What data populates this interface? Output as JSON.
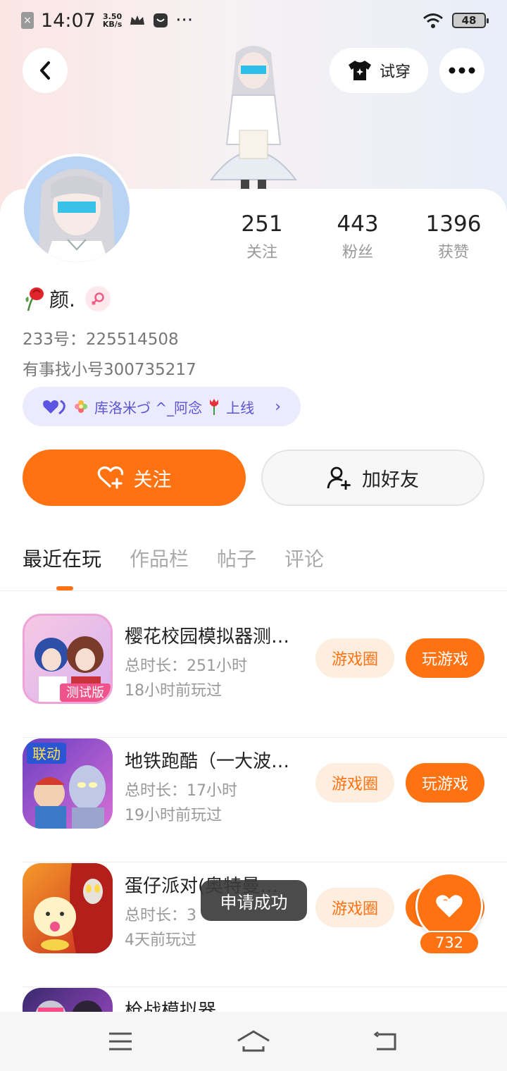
{
  "status_bar": {
    "time": "14:07",
    "speed_top": "3.50",
    "speed_unit": "KB/s",
    "dots": "···",
    "battery": "48"
  },
  "header": {
    "try_on_label": "试穿"
  },
  "profile": {
    "stats": [
      {
        "value": "251",
        "label": "关注"
      },
      {
        "value": "443",
        "label": "粉丝"
      },
      {
        "value": "1396",
        "label": "获赞"
      }
    ],
    "name": "颜.",
    "id_line": "233号：225514508",
    "bio": "有事找小号300735217",
    "guild": "库洛米づ ^_阿念",
    "guild_suffix": "上线",
    "follow_label": "关注",
    "add_friend_label": "加好友"
  },
  "tabs": [
    {
      "label": "最近在玩",
      "active": true
    },
    {
      "label": "作品栏",
      "active": false
    },
    {
      "label": "帖子",
      "active": false
    },
    {
      "label": "评论",
      "active": false
    }
  ],
  "games": [
    {
      "title": "樱花校园模拟器测…",
      "duration": "总时长：251小时",
      "last_played": "18小时前玩过",
      "badge": "测试版"
    },
    {
      "title": "地铁跑酷（一大波…",
      "duration": "总时长：17小时",
      "last_played": "19小时前玩过",
      "badge": "联动"
    },
    {
      "title": "蛋仔派对(奥特曼…",
      "duration": "总时长：3",
      "last_played": "4天前玩过",
      "badge": ""
    },
    {
      "title": "枪战模拟器",
      "duration": "",
      "last_played": "",
      "badge": ""
    }
  ],
  "game_buttons": {
    "circle_label": "游戏圈",
    "play_label": "玩游戏"
  },
  "toast": "申请成功",
  "like_count": "732",
  "colors": {
    "accent": "#ff7212",
    "guild_bg": "#ecebfd",
    "guild_text": "#5a54d6"
  },
  "icons": {
    "back": "back-arrow-icon",
    "more": "more-dots-icon",
    "try_on": "tshirt-icon",
    "follow": "heart-plus-icon",
    "add_friend": "user-plus-icon",
    "like": "heart-icon",
    "nav_menu": "menu-icon",
    "nav_home": "home-icon",
    "nav_back": "return-icon"
  }
}
